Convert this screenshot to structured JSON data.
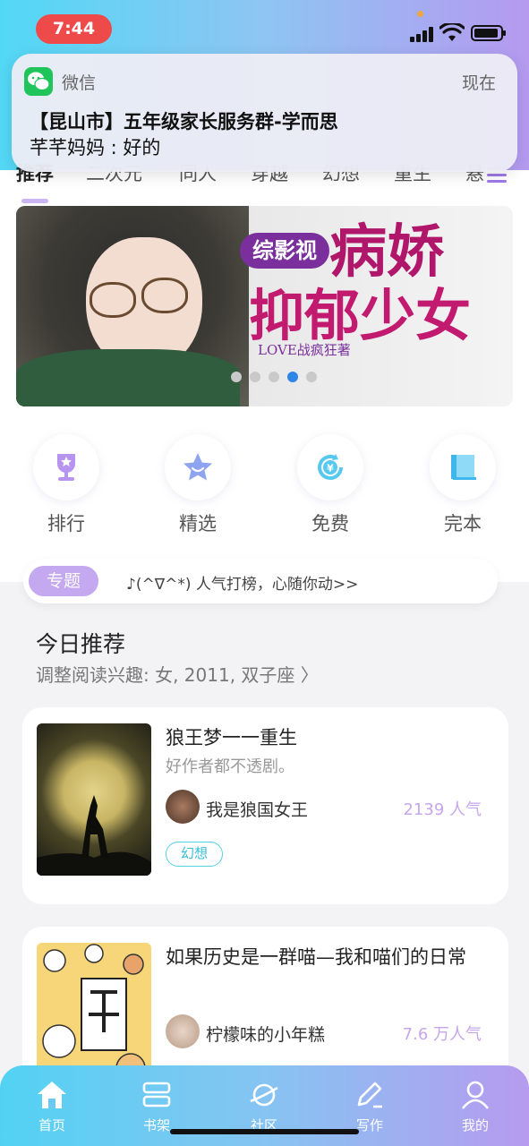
{
  "status_bar": {
    "time": "7:44"
  },
  "notification": {
    "app_name": "微信",
    "time": "现在",
    "title": "【昆山市】五年级家长服务群-学而思",
    "body": "芊芊妈妈 : 好的"
  },
  "tabs": [
    "推荐",
    "二次元",
    "同人",
    "穿越",
    "幻想",
    "重生",
    "悬"
  ],
  "banner": {
    "badge": "综影视",
    "title_line1": "病娇",
    "title_line2": "抑郁少女",
    "author": "LOVE战疯狂著",
    "dot_count": 5,
    "active_dot": 3
  },
  "quick_nav": [
    {
      "label": "排行",
      "icon": "trophy-icon"
    },
    {
      "label": "精选",
      "icon": "star-icon"
    },
    {
      "label": "免费",
      "icon": "yen-icon"
    },
    {
      "label": "完本",
      "icon": "book-icon"
    }
  ],
  "topic": {
    "badge": "专题",
    "text": "♪(^∇^*) 人气打榜，心随你动>>"
  },
  "today": {
    "title": "今日推荐",
    "subtitle": "调整阅读兴趣: 女, 2011, 双子座 〉"
  },
  "books": [
    {
      "title": "狼王梦一一重生",
      "desc": "好作者都不透剧。",
      "author": "我是狼国女王",
      "popularity": "2139 人气",
      "tag": "幻想"
    },
    {
      "title": "如果历史是一群喵—我和喵们的日常",
      "author": "柠檬味的小年糕",
      "popularity": "7.6 万人气"
    }
  ],
  "bottom_nav": [
    {
      "label": "首页",
      "icon": "home-icon"
    },
    {
      "label": "书架",
      "icon": "bookshelf-icon"
    },
    {
      "label": "社区",
      "icon": "planet-icon"
    },
    {
      "label": "写作",
      "icon": "pen-icon"
    },
    {
      "label": "我的",
      "icon": "user-icon"
    }
  ],
  "colors": {
    "accent_purple": "#b59af0",
    "accent_cyan": "#52d8f5",
    "popularity": "#c6a6ec",
    "tag": "#36bfd6"
  }
}
